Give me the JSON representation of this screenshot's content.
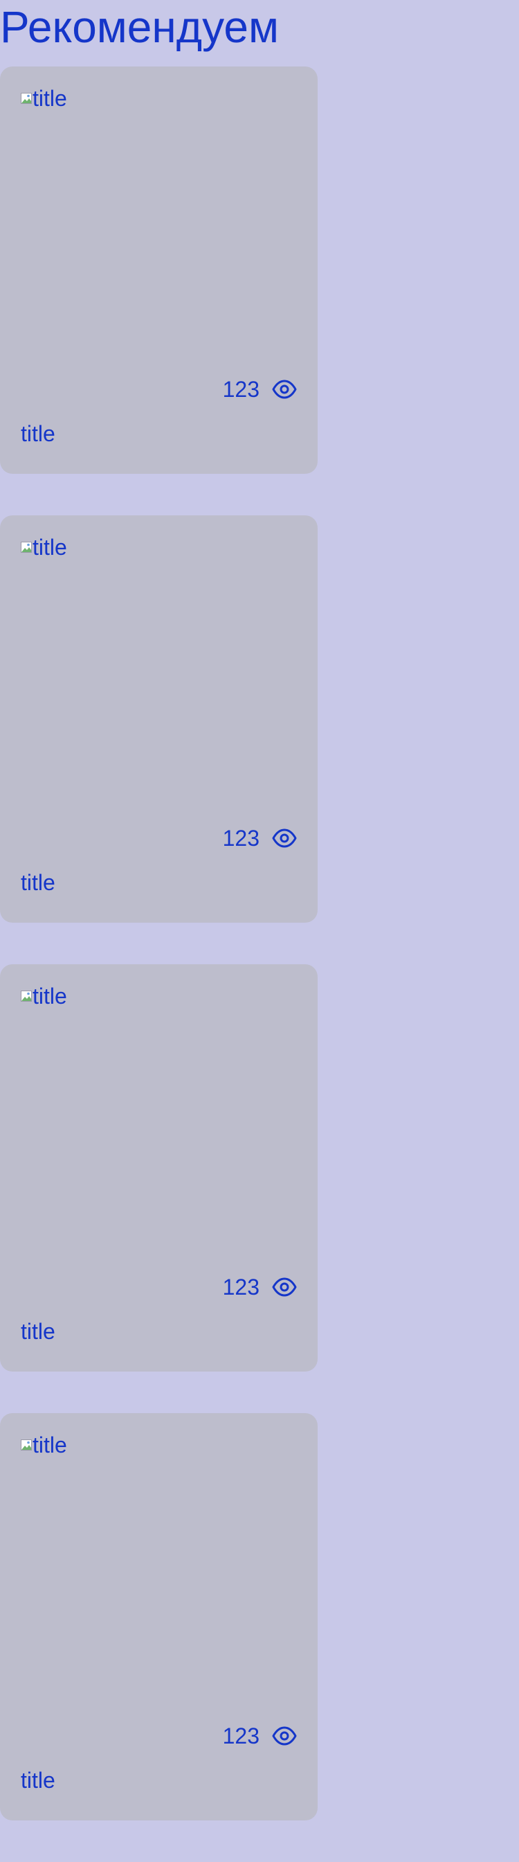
{
  "section": {
    "title": "Рекомендуем"
  },
  "cards": [
    {
      "image_alt": "title",
      "views": "123",
      "title": "title"
    },
    {
      "image_alt": "title",
      "views": "123",
      "title": "title"
    },
    {
      "image_alt": "title",
      "views": "123",
      "title": "title"
    },
    {
      "image_alt": "title",
      "views": "123",
      "title": "title"
    }
  ],
  "icons": {
    "views": "eye-icon",
    "image_placeholder": "broken-image-icon"
  },
  "colors": {
    "page_background": "#c8c8e8",
    "card_background": "#bdbdcc",
    "text": "#1536c9"
  }
}
